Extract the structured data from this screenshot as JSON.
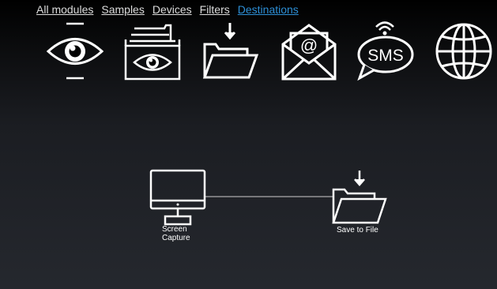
{
  "nav": {
    "items": [
      {
        "label": "All modules"
      },
      {
        "label": "Samples"
      },
      {
        "label": "Devices"
      },
      {
        "label": "Filters"
      },
      {
        "label": "Destinations"
      }
    ],
    "active": "Destinations",
    "colors": {
      "text": "#dcdcdc",
      "active": "#2d8fd6"
    }
  },
  "palette": {
    "icons": [
      {
        "icon": "eye-icon"
      },
      {
        "icon": "file-box-eye-icon"
      },
      {
        "icon": "save-folder-icon"
      },
      {
        "icon": "email-icon"
      },
      {
        "icon": "sms-icon"
      },
      {
        "icon": "globe-icon"
      }
    ],
    "sms_text": "SMS",
    "email_symbol": "@"
  },
  "pipeline": {
    "nodes": [
      {
        "label_line1": "Screen",
        "label_line2": "Capture",
        "icon": "monitor-icon"
      },
      {
        "label": "Save to File",
        "icon": "save-folder-icon"
      }
    ]
  }
}
